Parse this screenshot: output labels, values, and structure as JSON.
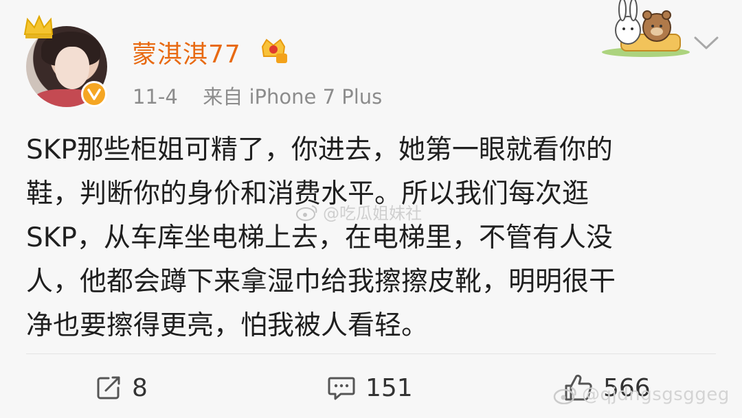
{
  "post": {
    "username": "蒙淇淇77",
    "date": "11-4",
    "source": "来自 iPhone 7 Plus",
    "body": "SKP那些柜姐可精了，你进去，她第一眼就看你的\n鞋，判断你的身价和消费水平。所以我们每次逛\nSKP，从车库坐电梯上去，在电梯里，不管有人没\n人，他都会蹲下来拿湿巾给我擦擦皮靴，明明很干\n净也要擦得更亮，怕我被人看轻。"
  },
  "actions": {
    "repost_count": "8",
    "comment_count": "151",
    "like_count": "566"
  },
  "watermarks": {
    "center": "@吃瓜姐妹社",
    "corner": "@qjdngsgsggeg"
  },
  "colors": {
    "username": "#e86a12",
    "meta": "#8c8c8c",
    "verified": "#f5a623"
  }
}
